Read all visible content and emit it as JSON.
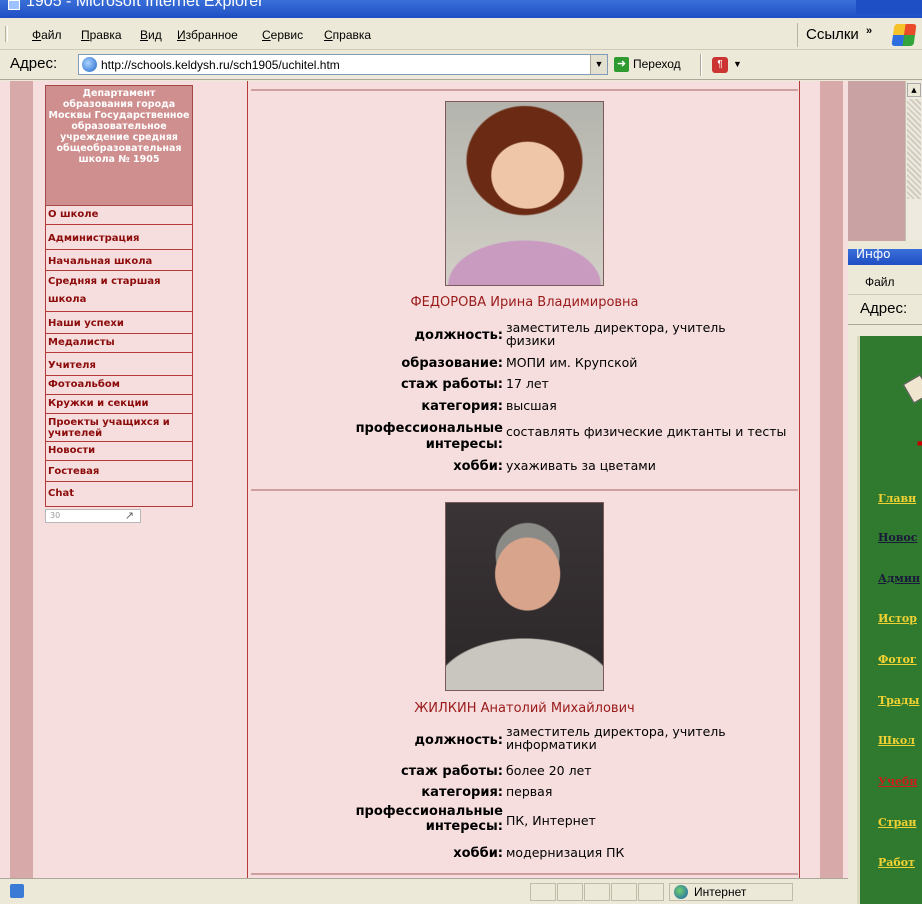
{
  "window": {
    "title": "1905 - Microsoft Internet Explorer"
  },
  "menu": {
    "items": [
      "Файл",
      "Правка",
      "Вид",
      "Избранное",
      "Сервис",
      "Справка"
    ],
    "links_label": "Ссылки",
    "links_chevron": "»"
  },
  "address": {
    "label": "Адрес:",
    "url": "http://schools.keldysh.ru/sch1905/uchitel.htm",
    "go_label": "Переход"
  },
  "sidebar": {
    "school_name": "Департамент образования города Москвы Государственное образовательное учреждение средняя общеобразовательная школа № 1905",
    "nav": [
      "О школе",
      "Администрация",
      "Начальная школа",
      "Средняя и старшая школа",
      "Наши успехи",
      "Медалисты",
      "Учителя",
      "Фотоальбом",
      "Кружки и секции",
      "Проекты учащихся и учителей",
      "Новости",
      "Гостевая",
      "Chat"
    ],
    "counter": "30"
  },
  "teachers": [
    {
      "name": "ФЕДОРОВА Ирина Владимировна",
      "rows": [
        {
          "label": "должность:",
          "value": "заместитель директора, учитель физики"
        },
        {
          "label": "образование:",
          "value": "МОПИ им. Крупской"
        },
        {
          "label": "стаж работы:",
          "value": "17 лет"
        },
        {
          "label": "категория:",
          "value": "высшая"
        },
        {
          "label": "профессиональные интересы:",
          "value": "составлять физические диктанты и тесты"
        },
        {
          "label": "хобби:",
          "value": "ухаживать за цветами"
        }
      ]
    },
    {
      "name": "ЖИЛКИН Анатолий Михайлович",
      "rows": [
        {
          "label": "должность:",
          "value": "заместитель директора, учитель информатики"
        },
        {
          "label": "стаж работы:",
          "value": "более 20 лет"
        },
        {
          "label": "категория:",
          "value": "первая"
        },
        {
          "label": "профессиональные интересы:",
          "value": "ПК, Интернет"
        },
        {
          "label": "хобби:",
          "value": "модернизация ПК"
        }
      ]
    }
  ],
  "status": {
    "zone": "Интернет"
  },
  "background_window": {
    "title": "Инфо",
    "menu_first": "Файл",
    "address_label": "Адрес:",
    "links": [
      {
        "text": "Главн",
        "color": "#f2d232"
      },
      {
        "text": "Новос",
        "color": "#1a1a3a"
      },
      {
        "text": "Админ",
        "color": "#1a1a3a"
      },
      {
        "text": "Истор",
        "color": "#f2d232"
      },
      {
        "text": "Фотог",
        "color": "#f2d232"
      },
      {
        "text": "Трады",
        "color": "#f2d232"
      },
      {
        "text": "Школ",
        "color": "#f2d232"
      },
      {
        "text": "Учебн",
        "color": "#d01a1a"
      },
      {
        "text": "Стран",
        "color": "#f2d232"
      },
      {
        "text": "Работ",
        "color": "#f2d232"
      }
    ]
  },
  "colors": {
    "accent": "#9a1a1a",
    "page_bg": "#f6dede",
    "stripe": "#d7a9a9"
  }
}
